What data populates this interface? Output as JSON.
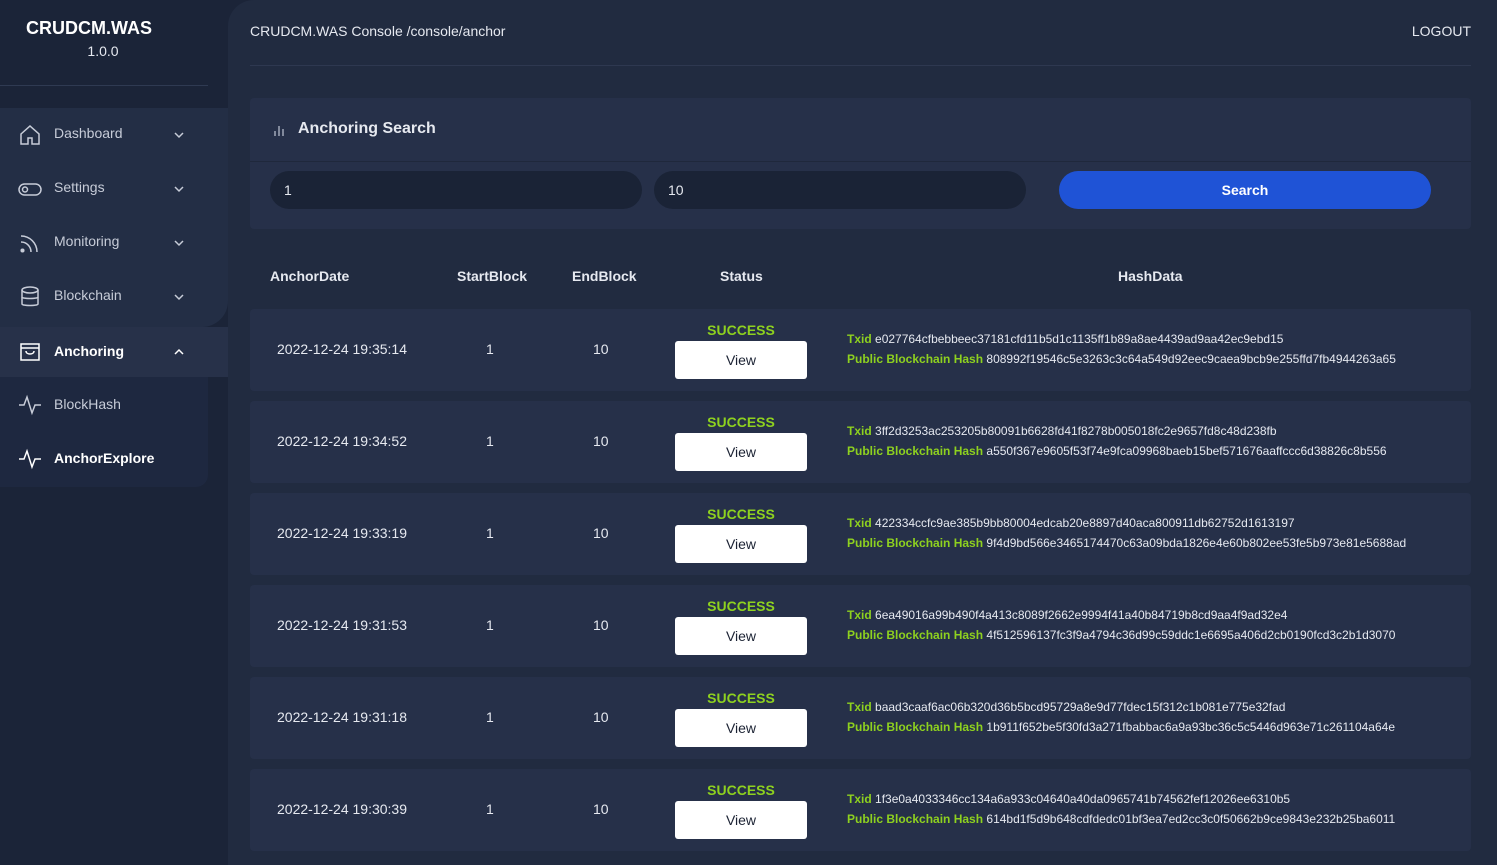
{
  "brand": {
    "title": "CRUDCM.WAS",
    "version": "1.0.0"
  },
  "sidebar": {
    "items": [
      {
        "label": "Dashboard"
      },
      {
        "label": "Settings"
      },
      {
        "label": "Monitoring"
      },
      {
        "label": "Blockchain"
      },
      {
        "label": "Anchoring"
      }
    ],
    "subitems": [
      {
        "label": "BlockHash"
      },
      {
        "label": "AnchorExplore"
      }
    ]
  },
  "header": {
    "breadcrumb": "CRUDCM.WAS Console /console/anchor",
    "logout": "LOGOUT"
  },
  "search": {
    "title": "Anchoring Search",
    "start_value": "1",
    "end_value": "10",
    "button": "Search"
  },
  "table": {
    "headers": [
      "AnchorDate",
      "StartBlock",
      "EndBlock",
      "Status",
      "HashData"
    ],
    "txid_label": "Txid",
    "hash_label": "Public Blockchain Hash",
    "view_label": "View",
    "rows": [
      {
        "date": "2022-12-24 19:35:14",
        "start": "1",
        "end": "10",
        "status": "SUCCESS",
        "txid": "e027764cfbebbeec37181cfd11b5d1c1135ff1b89a8ae4439ad9aa42ec9ebd15",
        "hash": "808992f19546c5e3263c3c64a549d92eec9caea9bcb9e255ffd7fb4944263a65"
      },
      {
        "date": "2022-12-24 19:34:52",
        "start": "1",
        "end": "10",
        "status": "SUCCESS",
        "txid": "3ff2d3253ac253205b80091b6628fd41f8278b005018fc2e9657fd8c48d238fb",
        "hash": "a550f367e9605f53f74e9fca09968baeb15bef571676aaffccc6d38826c8b556"
      },
      {
        "date": "2022-12-24 19:33:19",
        "start": "1",
        "end": "10",
        "status": "SUCCESS",
        "txid": "422334ccfc9ae385b9bb80004edcab20e8897d40aca800911db62752d1613197",
        "hash": "9f4d9bd566e3465174470c63a09bda1826e4e60b802ee53fe5b973e81e5688ad"
      },
      {
        "date": "2022-12-24 19:31:53",
        "start": "1",
        "end": "10",
        "status": "SUCCESS",
        "txid": "6ea49016a99b490f4a413c8089f2662e9994f41a40b84719b8cd9aa4f9ad32e4",
        "hash": "4f512596137fc3f9a4794c36d99c59ddc1e6695a406d2cb0190fcd3c2b1d3070"
      },
      {
        "date": "2022-12-24 19:31:18",
        "start": "1",
        "end": "10",
        "status": "SUCCESS",
        "txid": "baad3caaf6ac06b320d36b5bcd95729a8e9d77fdec15f312c1b081e775e32fad",
        "hash": "1b911f652be5f30fd3a271fbabbac6a9a93bc36c5c5446d963e71c261104a64e"
      },
      {
        "date": "2022-12-24 19:30:39",
        "start": "1",
        "end": "10",
        "status": "SUCCESS",
        "txid": "1f3e0a4033346cc134a6a933c04640a40da0965741b74562fef12026ee6310b5",
        "hash": "614bd1f5d9b648cdfdedc01bf3ea7ed2cc3c0f50662b9ce9843e232b25ba6011"
      }
    ]
  },
  "colors": {
    "accent": "#1f53d6",
    "success": "#8ed11f",
    "background": "#1b2438",
    "card": "#263049"
  }
}
